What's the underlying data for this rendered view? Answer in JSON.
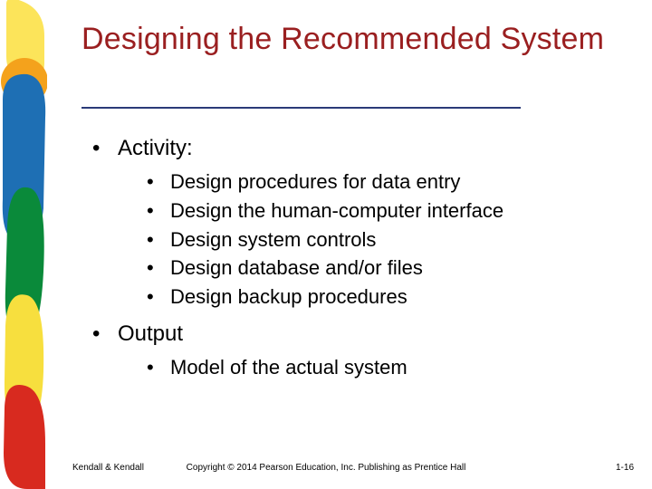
{
  "title": "Designing the Recommended System",
  "content": {
    "items": [
      {
        "label": "Activity:",
        "sub": [
          "Design procedures for data entry",
          "Design the human-computer interface",
          "Design system controls",
          "Design database and/or files",
          "Design backup procedures"
        ]
      },
      {
        "label": "Output",
        "sub": [
          "Model of the actual system"
        ]
      }
    ]
  },
  "footer": {
    "left": "Kendall & Kendall",
    "center": "Copyright © 2014 Pearson Education, Inc. Publishing as Prentice Hall",
    "right": "1-16"
  },
  "sidebar_colors": {
    "yellow_top": "#fce45a",
    "orange": "#f4a21c",
    "blue": "#1e6fb4",
    "green": "#0a8a3a",
    "yellow_bottom": "#f7df3e",
    "red": "#d82a1f"
  }
}
